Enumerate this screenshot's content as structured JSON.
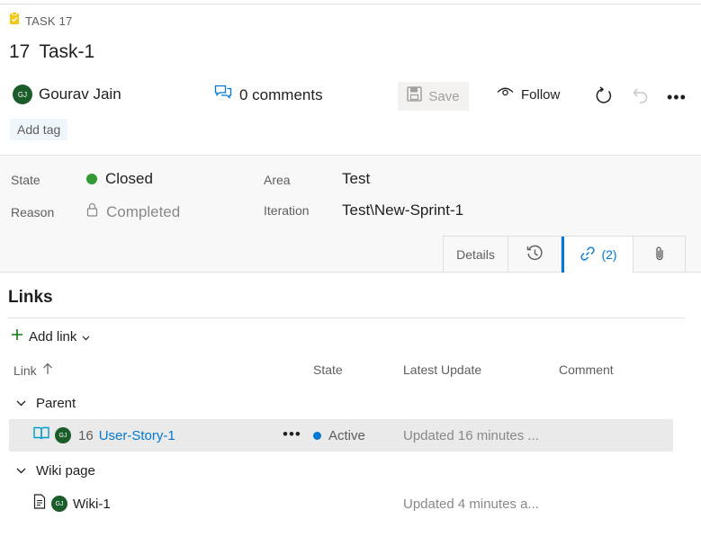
{
  "header": {
    "work_item_type": "TASK 17",
    "id": "17",
    "title": "Task-1"
  },
  "owner": {
    "initials": "GJ",
    "name": "Gourav Jain"
  },
  "toolbar": {
    "comments_label": "0 comments",
    "save_label": "Save",
    "follow_label": "Follow",
    "more_label": "•••"
  },
  "tags": {
    "add_tag_label": "Add tag"
  },
  "fields": {
    "state_label": "State",
    "state_value": "Closed",
    "reason_label": "Reason",
    "reason_value": "Completed",
    "area_label": "Area",
    "area_value": "Test",
    "iteration_label": "Iteration",
    "iteration_value": "Test\\New-Sprint-1"
  },
  "tabs": {
    "details_label": "Details",
    "links_count": "(2)"
  },
  "links": {
    "heading": "Links",
    "add_link_label": "Add link",
    "columns": {
      "link": "Link",
      "state": "State",
      "latest_update": "Latest Update",
      "comment": "Comment"
    },
    "groups": [
      {
        "label": "Parent",
        "items": [
          {
            "id": "16",
            "title": "User-Story-1",
            "initials": "GJ",
            "state": "Active",
            "update": "Updated 16 minutes ...",
            "more": "•••"
          }
        ]
      },
      {
        "label": "Wiki page",
        "items": [
          {
            "title": "Wiki-1",
            "initials": "GJ",
            "update": "Updated 4 minutes a..."
          }
        ]
      }
    ]
  },
  "colors": {
    "accent": "#0078d4",
    "state_closed": "#339933",
    "avatar": "#1a5c2a",
    "task_icon": "#f2c811"
  }
}
